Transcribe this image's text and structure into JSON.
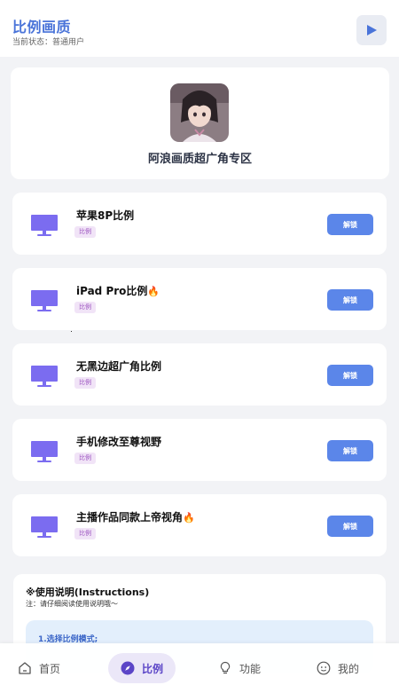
{
  "header": {
    "title": "比例画质",
    "status": "当前状态：普通用户"
  },
  "profile": {
    "name": "阿浪画质超广角专区"
  },
  "items": [
    {
      "title": "苹果8P比例",
      "fire": "",
      "tag": "比例",
      "button": "解锁"
    },
    {
      "title": "iPad Pro比例",
      "fire": "🔥",
      "tag": "比例",
      "button": "解锁"
    },
    {
      "title": "无黑边超广角比例",
      "fire": "",
      "tag": "比例",
      "button": "解锁"
    },
    {
      "title": "手机修改至尊视野",
      "fire": "",
      "tag": "比例",
      "button": "解锁"
    },
    {
      "title": "主播作品同款上帝视角",
      "fire": "🔥",
      "tag": "比例",
      "button": "解锁"
    }
  ],
  "instructions": {
    "title": "※使用说明(Instructions)",
    "note": "注：请仔细阅读使用说明哦～",
    "step1": "1.选择比例模式;"
  },
  "nav": {
    "home": "首页",
    "ratio": "比例",
    "features": "功能",
    "mine": "我的"
  },
  "colors": {
    "brand": "#4a74d9",
    "button": "#5b86e9",
    "monitor": "#7b6cf0",
    "tag_bg": "#f1e4f7",
    "tag_text": "#9a4fbf",
    "nav_active": "#5b45c7"
  }
}
